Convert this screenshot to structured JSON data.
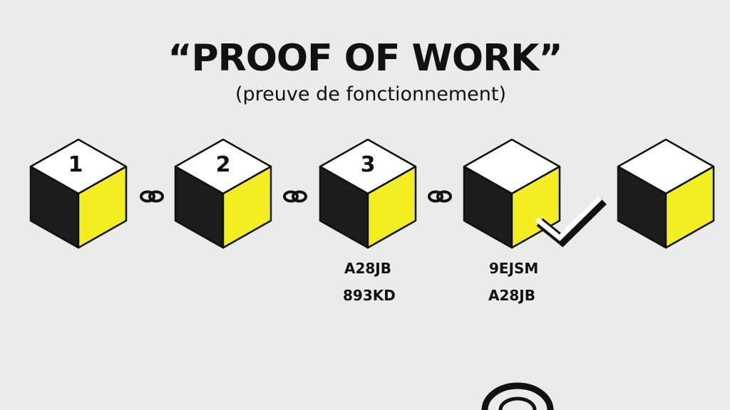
{
  "title": "“PROOF OF WORK”",
  "subtitle": "(preuve de fonctionnement)",
  "colors": {
    "background": "#ebebeb",
    "cube_top": "#ffffff",
    "cube_left": "#1c1c1c",
    "cube_right": "#f2ee22",
    "ink": "#111111"
  },
  "blocks": [
    {
      "label": "1",
      "hashes": []
    },
    {
      "label": "2",
      "hashes": []
    },
    {
      "label": "3",
      "hashes": [
        "A28JB",
        "893KD"
      ]
    },
    {
      "label": "",
      "hashes": [
        "9EJSM",
        "A28JB"
      ],
      "validated": true
    },
    {
      "label": "",
      "hashes": []
    }
  ],
  "links": [
    "chain-link-icon",
    "chain-link-icon",
    "chain-link-icon"
  ],
  "icons": {
    "check": "check-icon",
    "partial_circle": "circle-icon"
  }
}
